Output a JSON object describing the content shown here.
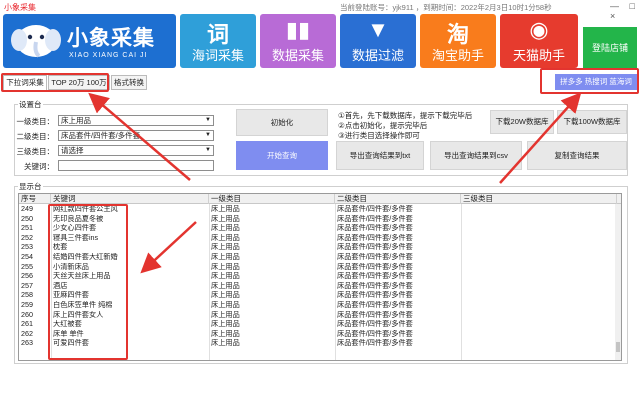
{
  "window": {
    "title": "小象采集",
    "account_info": "当前登陆账号：yjk911 ，到期时间：2022年2月3日10时1分58秒",
    "controls": "— □ ×"
  },
  "logo": {
    "text": "小象采集",
    "pinyin": "XIAO XIANG CAI JI"
  },
  "nav_tiles": [
    {
      "glyph": "词",
      "label": "海词采集",
      "color": "#2f9fd9"
    },
    {
      "glyph": "▮▮",
      "label": "数据采集",
      "color": "#b86bd6"
    },
    {
      "glyph": "▼",
      "label": "数据过滤",
      "color": "#2a6fd3"
    },
    {
      "glyph": "淘",
      "label": "淘宝助手",
      "color": "#f97c1c"
    },
    {
      "glyph": "◉",
      "label": "天猫助手",
      "color": "#e63b2e"
    }
  ],
  "login_button": "登陆店铺",
  "tabs": [
    "下拉词采集",
    "TOP 20万 100万",
    "格式转换"
  ],
  "platform_bar": "拼多多 热搜词 蓝海词",
  "settings": {
    "group_label": "设置台",
    "level1_label": "一级类目：",
    "level1_value": "床上用品",
    "level2_label": "二级类目：",
    "level2_value": "床品套件/四件套/多件套",
    "level3_label": "三级类目：",
    "level3_value": "请选择",
    "keyword_label": "关键词：",
    "keyword_value": ""
  },
  "buttons": {
    "init": "初始化",
    "start_query": "开始查询",
    "download_20w": "下载20W数据库",
    "download_100w": "下载100W数据库",
    "export_txt": "导出查询结果到txt",
    "export_csv": "导出查询结果到csv",
    "copy_results": "复制查询结果"
  },
  "hints": [
    "①首先，先下载数据库，提示下载完毕后",
    "②点击初始化，提示完毕后",
    "③进行类目选择操作即可"
  ],
  "results": {
    "group_label": "显示台",
    "columns": [
      "序号",
      "关键词",
      "一级类目",
      "二级类目",
      "三级类目"
    ],
    "rows": [
      {
        "no": "249",
        "keyword": "网红款四件套公主风",
        "l1": "床上用品",
        "l2": "床品套件/四件套/多件套",
        "l3": ""
      },
      {
        "no": "250",
        "keyword": "无印良品夏冬被",
        "l1": "床上用品",
        "l2": "床品套件/四件套/多件套",
        "l3": ""
      },
      {
        "no": "251",
        "keyword": "少女心四件套",
        "l1": "床上用品",
        "l2": "床品套件/四件套/多件套",
        "l3": ""
      },
      {
        "no": "252",
        "keyword": "寝具三件套ins",
        "l1": "床上用品",
        "l2": "床品套件/四件套/多件套",
        "l3": ""
      },
      {
        "no": "253",
        "keyword": "枕套",
        "l1": "床上用品",
        "l2": "床品套件/四件套/多件套",
        "l3": ""
      },
      {
        "no": "254",
        "keyword": "结婚四件套大红新婚",
        "l1": "床上用品",
        "l2": "床品套件/四件套/多件套",
        "l3": ""
      },
      {
        "no": "255",
        "keyword": "小清新床品",
        "l1": "床上用品",
        "l2": "床品套件/四件套/多件套",
        "l3": ""
      },
      {
        "no": "256",
        "keyword": "天丝天丝床上用品",
        "l1": "床上用品",
        "l2": "床品套件/四件套/多件套",
        "l3": ""
      },
      {
        "no": "257",
        "keyword": "酒店",
        "l1": "床上用品",
        "l2": "床品套件/四件套/多件套",
        "l3": ""
      },
      {
        "no": "258",
        "keyword": "亚麻四件套",
        "l1": "床上用品",
        "l2": "床品套件/四件套/多件套",
        "l3": ""
      },
      {
        "no": "259",
        "keyword": "白色床笠单件 纯棉",
        "l1": "床上用品",
        "l2": "床品套件/四件套/多件套",
        "l3": ""
      },
      {
        "no": "260",
        "keyword": "床上四件套女人",
        "l1": "床上用品",
        "l2": "床品套件/四件套/多件套",
        "l3": ""
      },
      {
        "no": "261",
        "keyword": "大红被套",
        "l1": "床上用品",
        "l2": "床品套件/四件套/多件套",
        "l3": ""
      },
      {
        "no": "262",
        "keyword": "床单 单件",
        "l1": "床上用品",
        "l2": "床品套件/四件套/多件套",
        "l3": ""
      },
      {
        "no": "263",
        "keyword": "可爱四件套",
        "l1": "床上用品",
        "l2": "床品套件/四件套/多件套",
        "l3": ""
      }
    ]
  },
  "colors": {
    "accent_red": "#e3342f",
    "button_blue": "#7f8df0",
    "login_green": "#23b54a"
  }
}
